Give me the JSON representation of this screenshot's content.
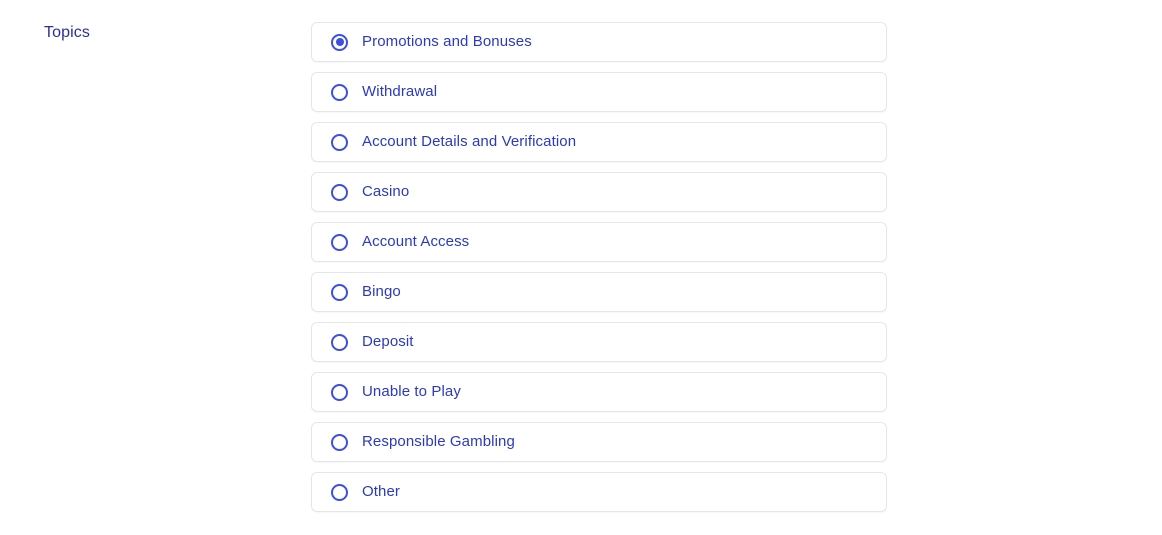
{
  "section": {
    "heading": "Topics"
  },
  "colors": {
    "accent": "#3c4fe0",
    "label_text": "#2b3abf",
    "heading_text": "#2a3192",
    "card_border": "#e4e6ea",
    "card_background": "#ffffff",
    "page_background": "#ffffff"
  },
  "topics": {
    "selected_value": "Promotions and Bonuses",
    "options": [
      {
        "label": "Promotions and Bonuses",
        "selected": true,
        "icon": "radio-selected-icon"
      },
      {
        "label": "Withdrawal",
        "selected": false,
        "icon": "radio-unselected-icon"
      },
      {
        "label": "Account Details and Verification",
        "selected": false,
        "icon": "radio-unselected-icon"
      },
      {
        "label": "Casino",
        "selected": false,
        "icon": "radio-unselected-icon"
      },
      {
        "label": "Account Access",
        "selected": false,
        "icon": "radio-unselected-icon"
      },
      {
        "label": "Bingo",
        "selected": false,
        "icon": "radio-unselected-icon"
      },
      {
        "label": "Deposit",
        "selected": false,
        "icon": "radio-unselected-icon"
      },
      {
        "label": "Unable to Play",
        "selected": false,
        "icon": "radio-unselected-icon"
      },
      {
        "label": "Responsible Gambling",
        "selected": false,
        "icon": "radio-unselected-icon"
      },
      {
        "label": "Other",
        "selected": false,
        "icon": "radio-unselected-icon"
      }
    ]
  }
}
